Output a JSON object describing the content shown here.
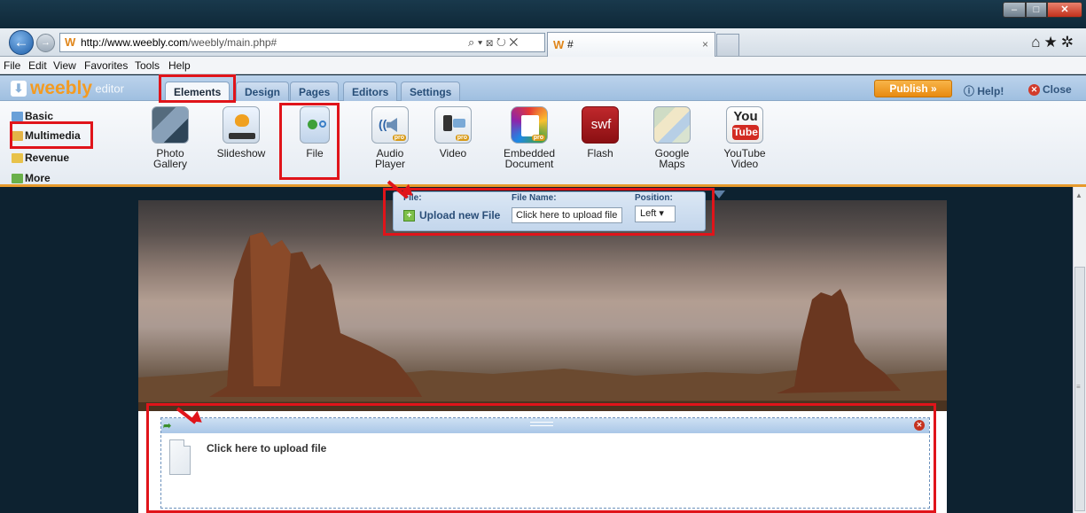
{
  "browser": {
    "url_domain": "http://www.weebly.com",
    "url_path": "/weebly/main.php#",
    "address_tools": "⌕ ▾ ⊠ ↻ ✕",
    "tab_title": "#",
    "tab_close": "×",
    "icons": [
      "home-icon",
      "favorites-star-icon",
      "tools-gear-icon"
    ]
  },
  "menu": [
    "File",
    "Edit",
    "View",
    "Favorites",
    "Tools",
    "Help"
  ],
  "weebly": {
    "logo": "weebly",
    "logo_suffix": "editor",
    "tabs": [
      "Elements",
      "Design",
      "Pages",
      "Editors",
      "Settings"
    ],
    "publish": "Publish »",
    "help": "Help!",
    "close": "Close"
  },
  "categories": [
    "Basic",
    "Multimedia",
    "Revenue",
    "More"
  ],
  "elements": [
    {
      "label1": "Photo",
      "label2": "Gallery"
    },
    {
      "label1": "Slideshow",
      "label2": ""
    },
    {
      "label1": "File",
      "label2": ""
    },
    {
      "label1": "Audio",
      "label2": "Player",
      "pro": "pro"
    },
    {
      "label1": "Video",
      "label2": "",
      "pro": "pro"
    },
    {
      "label1": "Embedded",
      "label2": "Document",
      "pro": "pro"
    },
    {
      "label1": "Flash",
      "label2": "",
      "icon_text": "swf"
    },
    {
      "label1": "Google",
      "label2": "Maps"
    },
    {
      "label1": "YouTube",
      "label2": "Video",
      "icon_text": "You",
      "icon_text2": "Tube"
    }
  ],
  "upload_popup": {
    "file_header": "File:",
    "name_header": "File Name:",
    "position_header": "Position:",
    "upload_new": "Upload new File",
    "filename_value": "Click here to upload file",
    "position_value": "Left"
  },
  "file_box": {
    "label": "Click here to upload file"
  },
  "colors": {
    "highlight": "#e0141a",
    "weebly_orange": "#f39b22",
    "toolbar_accent": "#e79a2c"
  }
}
